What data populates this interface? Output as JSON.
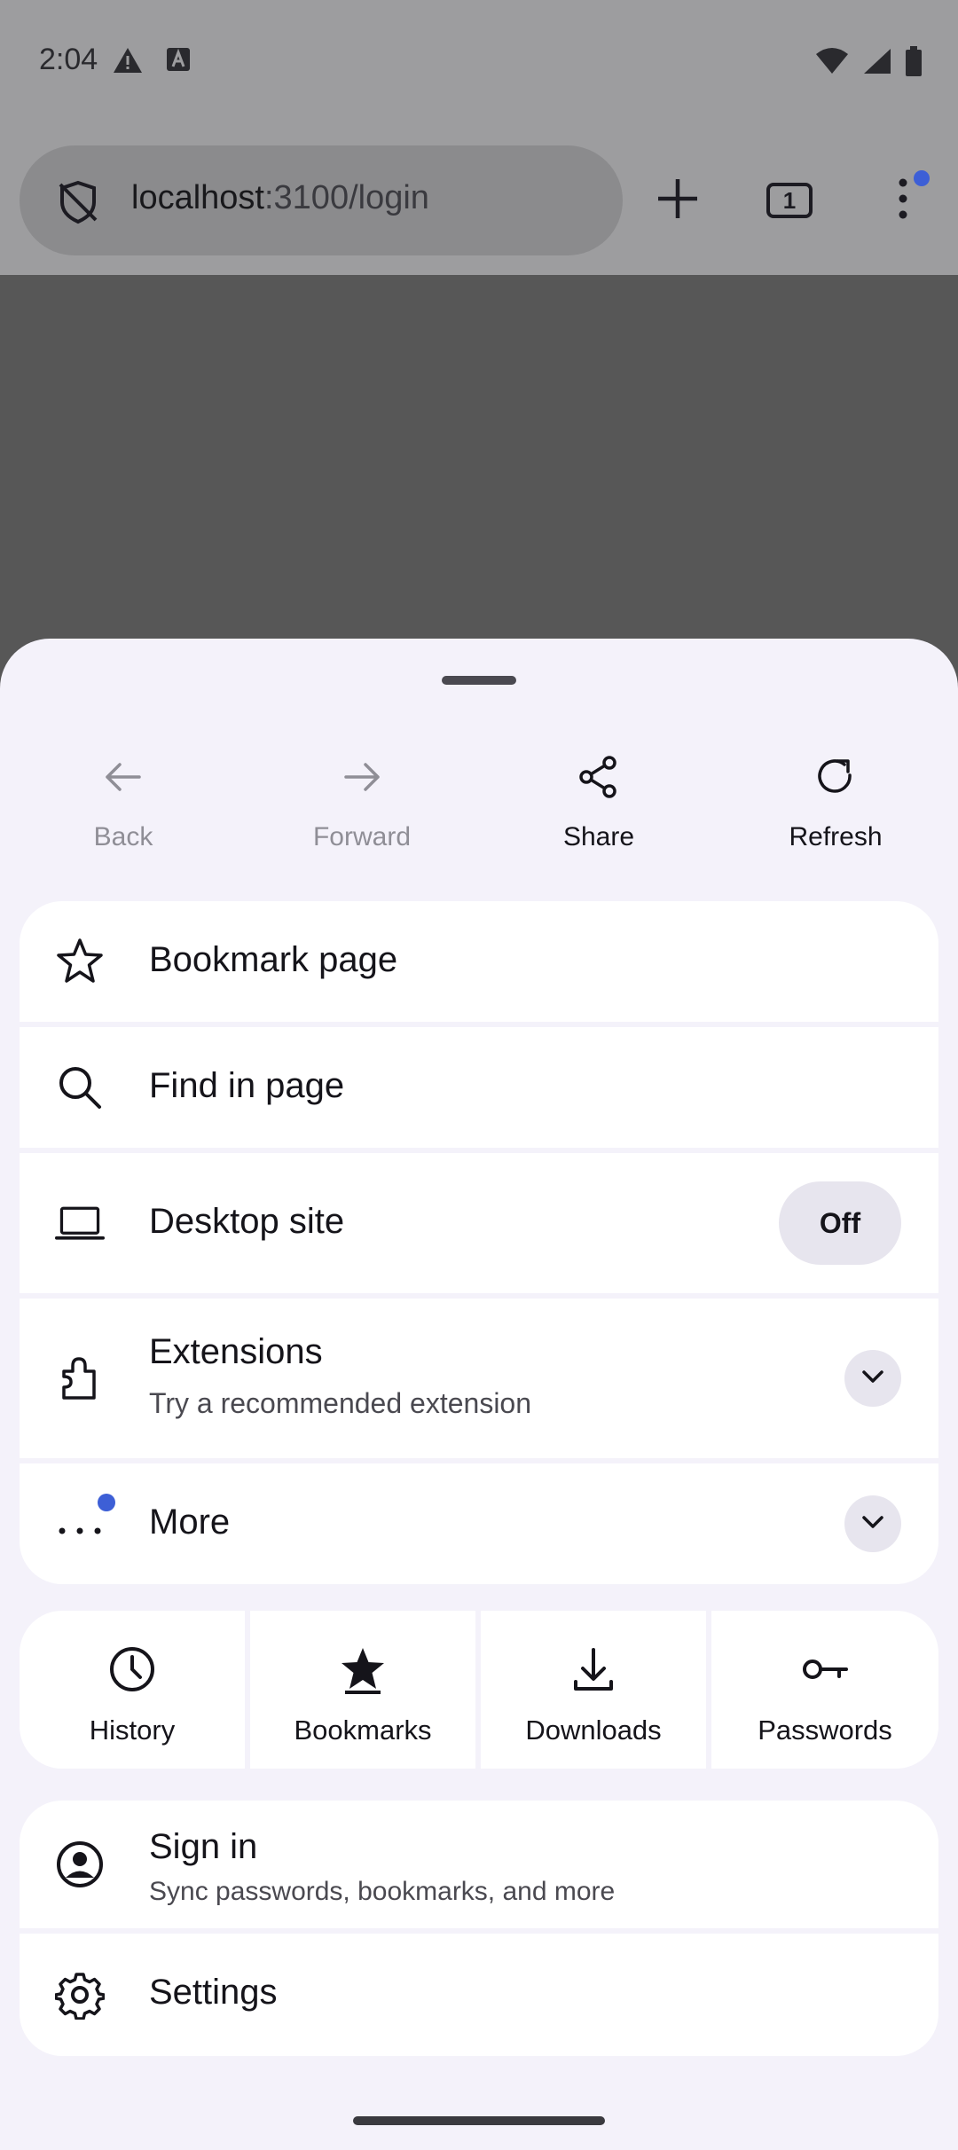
{
  "status_bar": {
    "time": "2:04"
  },
  "toolbar": {
    "url_host": "localhost",
    "url_path": ":3100/login",
    "tab_count": "1"
  },
  "nav": {
    "back": "Back",
    "forward": "Forward",
    "share": "Share",
    "refresh": "Refresh"
  },
  "menu": {
    "bookmark_page": "Bookmark page",
    "find_in_page": "Find in page",
    "desktop_site": "Desktop site",
    "desktop_site_state": "Off",
    "extensions": "Extensions",
    "extensions_sub": "Try a recommended extension",
    "more": "More"
  },
  "quick": [
    {
      "label": "History",
      "icon": "clock-icon"
    },
    {
      "label": "Bookmarks",
      "icon": "star-filled-icon"
    },
    {
      "label": "Downloads",
      "icon": "download-icon"
    },
    {
      "label": "Passwords",
      "icon": "key-icon"
    }
  ],
  "account": {
    "sign_in": "Sign in",
    "sign_in_sub": "Sync passwords, bookmarks, and more",
    "settings": "Settings"
  },
  "colors": {
    "accent": "#3d5fd6",
    "sheet_bg": "#f4f2fa",
    "card_bg": "#ffffff",
    "scrim": "#575757"
  }
}
